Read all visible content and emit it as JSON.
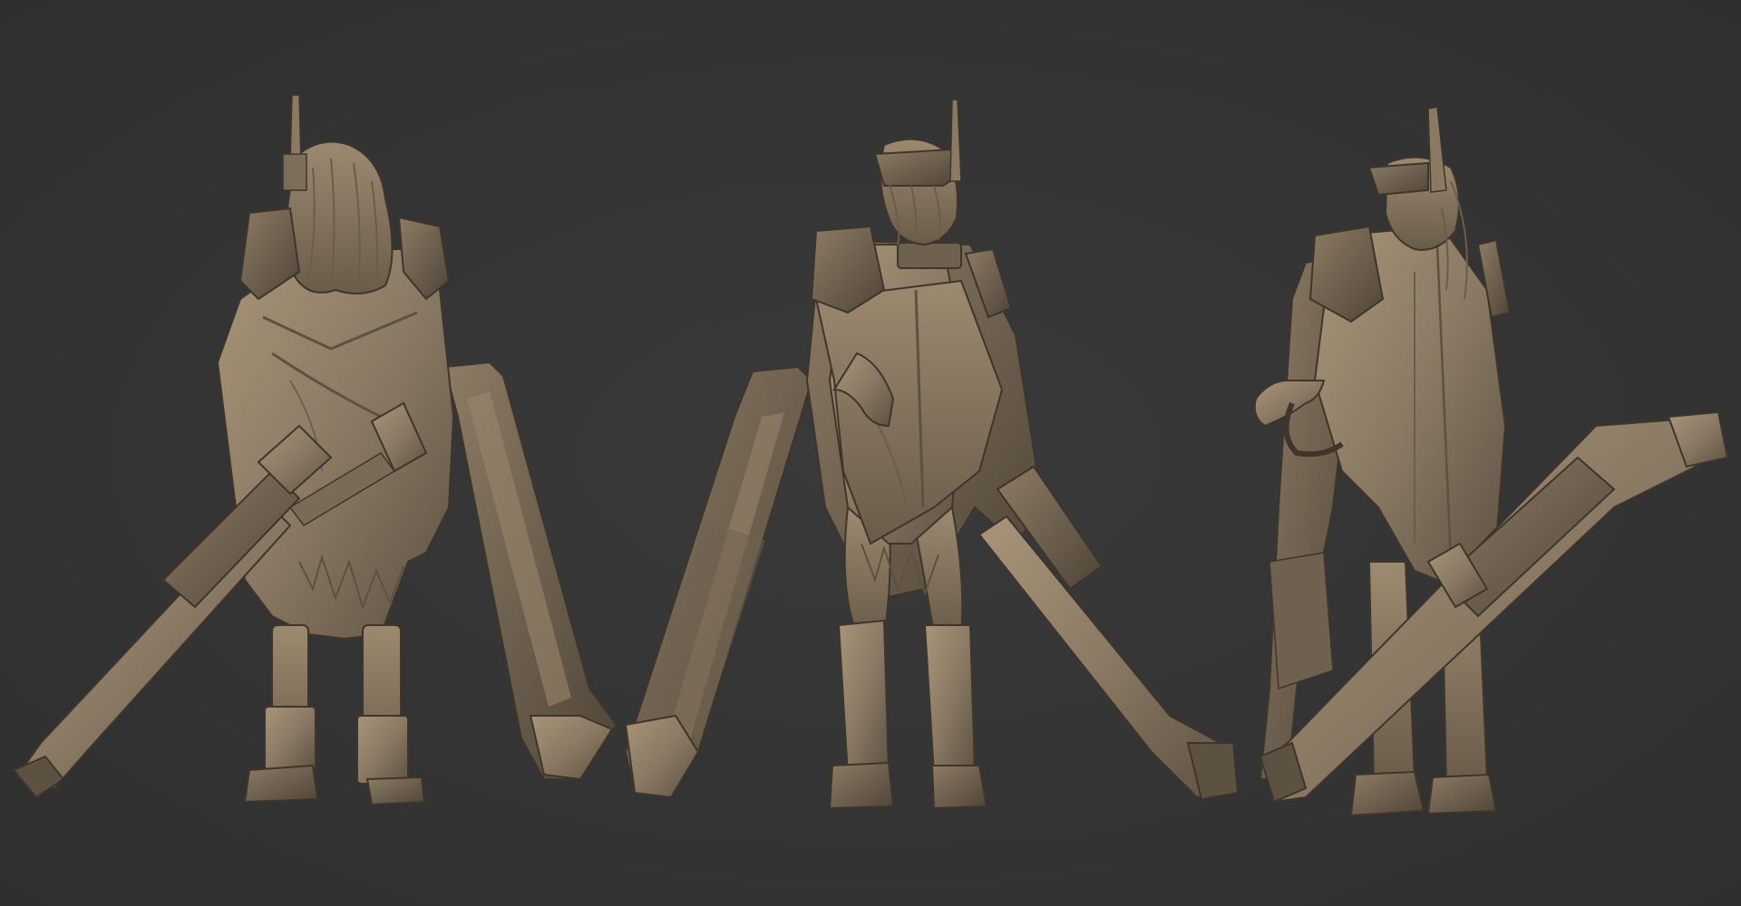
{
  "scene": {
    "background_color": "#353535",
    "clay_color": "#8a7a64",
    "clay_shadow": "#5d5142",
    "clay_highlight": "#a89479",
    "views": [
      {
        "name": "back-view"
      },
      {
        "name": "front-view"
      },
      {
        "name": "three-quarter-view"
      }
    ]
  }
}
